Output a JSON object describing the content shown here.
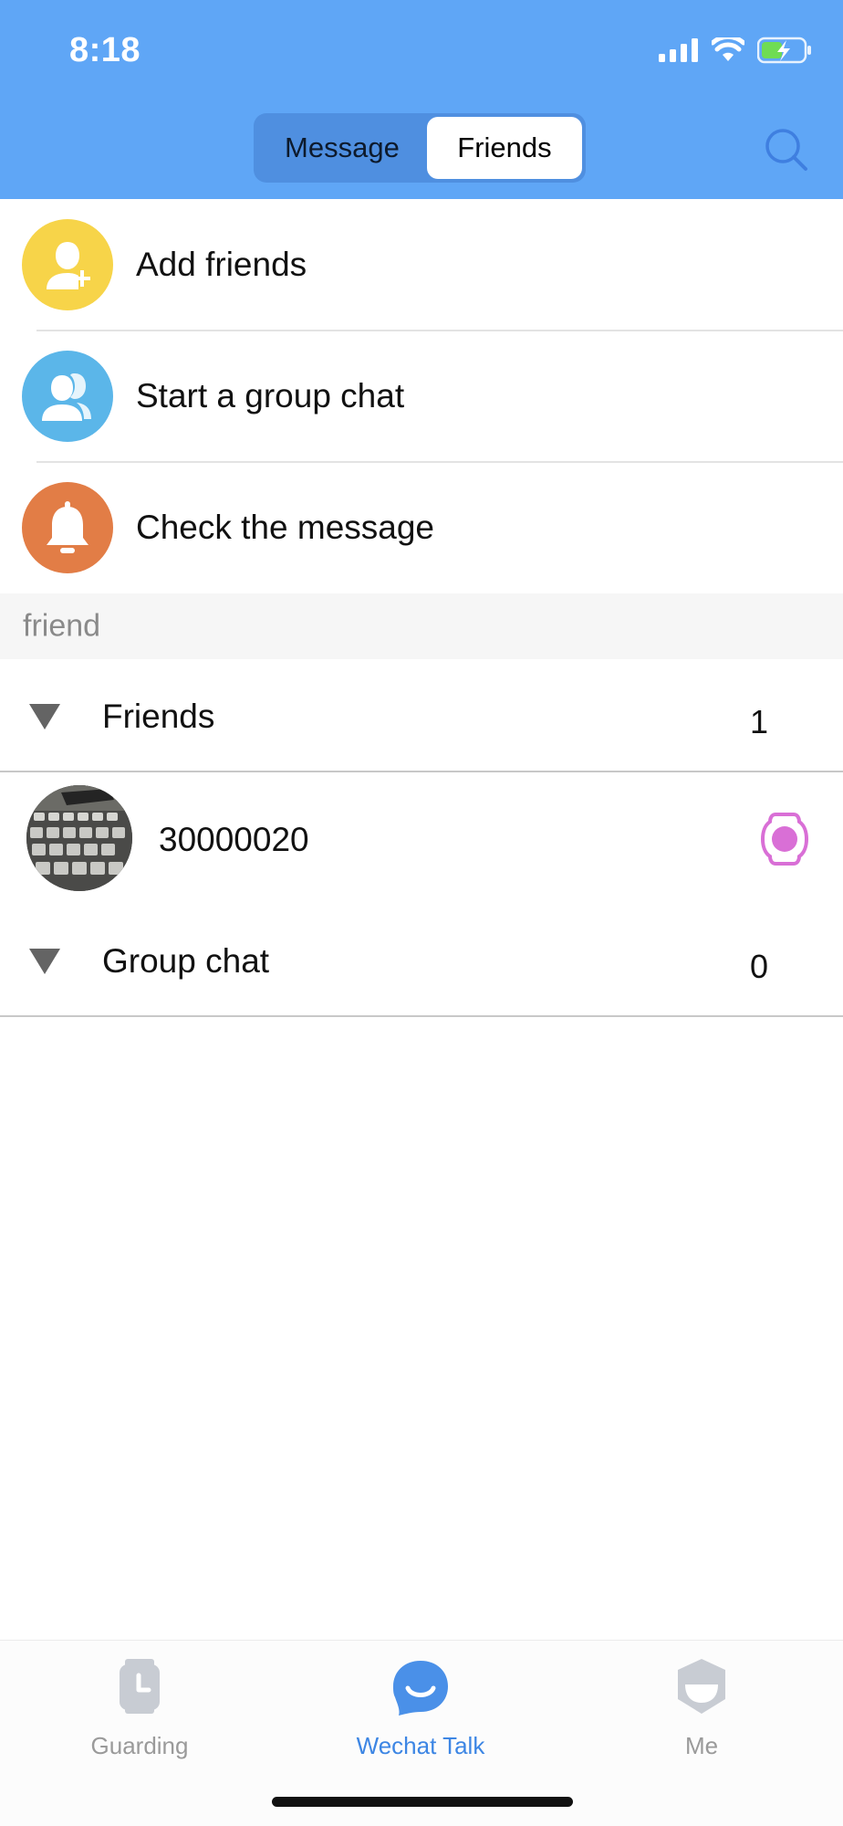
{
  "status_bar": {
    "time": "8:18"
  },
  "header": {
    "tabs": [
      {
        "label": "Message",
        "selected": false
      },
      {
        "label": "Friends",
        "selected": true
      }
    ],
    "search_icon": "search-icon",
    "background_color": "#5fa6f6"
  },
  "actions": [
    {
      "label": "Add friends",
      "icon": "add-person-icon",
      "color": "#f7d449"
    },
    {
      "label": "Start a group chat",
      "icon": "group-icon",
      "color": "#5bb6e9"
    },
    {
      "label": "Check the message",
      "icon": "bell-icon",
      "color": "#e27d46"
    }
  ],
  "section_title": "friend",
  "groups": [
    {
      "name": "Friends",
      "count": "1"
    },
    {
      "name": "Group chat",
      "count": "0"
    }
  ],
  "friends": [
    {
      "name": "30000020",
      "avatar": "keyboard-photo",
      "device_icon": "watch-device-icon",
      "device_color": "#d96fd6"
    }
  ],
  "tabbar": {
    "items": [
      {
        "label": "Guarding",
        "icon": "watch-icon",
        "active": false
      },
      {
        "label": "Wechat Talk",
        "icon": "chat-bubble-icon",
        "active": true
      },
      {
        "label": "Me",
        "icon": "profile-icon",
        "active": false
      }
    ],
    "active_color": "#3d86e4",
    "inactive_color": "#9a9a9a"
  }
}
